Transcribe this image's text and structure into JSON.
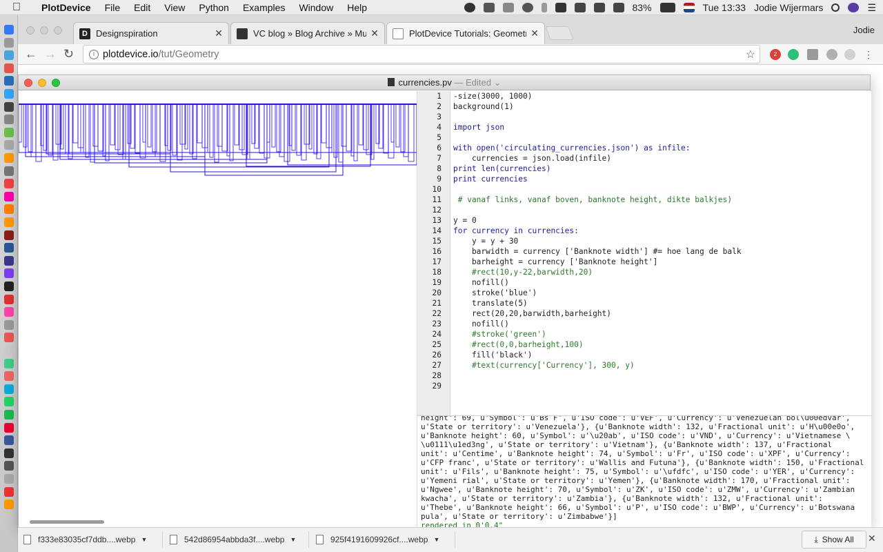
{
  "menubar": {
    "app_name": "PlotDevice",
    "menus": [
      "File",
      "Edit",
      "View",
      "Python",
      "Examples",
      "Window",
      "Help"
    ],
    "battery": "83%",
    "clock": "Tue 13:33",
    "user": "Jodie Wijermars"
  },
  "browser": {
    "profile": "Jodie",
    "tabs": [
      {
        "title": "Designspiration",
        "favicon": "D"
      },
      {
        "title": "VC blog » Blog Archive » Musi",
        "favicon": ""
      },
      {
        "title": "PlotDevice Tutorials: Geometry",
        "favicon": ""
      }
    ],
    "url_host": "plotdevice.io",
    "url_path": "/tut/Geometry",
    "ext_badge": "2"
  },
  "pd_window": {
    "filename": "currencies.pv",
    "status": "— Edited",
    "code_lines": [
      "-size(3000, 1000)",
      "background(1)",
      "",
      "import json",
      "",
      "with open('circulating_currencies.json') as infile:",
      "    currencies = json.load(infile)",
      "print len(currencies)",
      "print currencies",
      "",
      " # vanaf links, vanaf boven, banknote height, dikte balkjes)",
      "",
      "y = 0",
      "for currency in currencies:",
      "    y = y + 30",
      "    barwidth = currency ['Banknote width'] #= hoe lang de balk",
      "    barheight = currency ['Banknote height']",
      "    #rect(10,y-22,barwidth,20)",
      "    nofill()",
      "    stroke('blue')",
      "    translate(5)",
      "    rect(20,20,barwidth,barheight)",
      "    nofill()",
      "    #stroke('green')",
      "    #rect(0,0,barheight,100)",
      "    fill('black')",
      "    #text(currency['Currency'], 300, y)",
      "",
      ""
    ],
    "console_output": "height': 69, u'Symbol': u'Bs F', u'ISO code': u'VEF', u'Currency': u'Venezuelan bol\\u00edvar',\nu'State or territory': u'Venezuela'}, {u'Banknote width': 132, u'Fractional unit': u'H\\u00e0o',\nu'Banknote height': 60, u'Symbol': u'\\u20ab', u'ISO code': u'VND', u'Currency': u'Vietnamese \\\n\\u0111\\u1ed3ng', u'State or territory': u'Vietnam'}, {u'Banknote width': 137, u'Fractional\nunit': u'Centime', u'Banknote height': 74, u'Symbol': u'Fr', u'ISO code': u'XPF', u'Currency':\nu'CFP franc', u'State or territory': u'Wallis and Futuna'}, {u'Banknote width': 150, u'Fractional\nunit': u'Fils', u'Banknote height': 75, u'Symbol': u'\\ufdfc', u'ISO code': u'YER', u'Currency':\nu'Yemeni rial', u'State or territory': u'Yemen'}, {u'Banknote width': 170, u'Fractional unit':\nu'Ngwee', u'Banknote height': 70, u'Symbol': u'ZK', u'ISO code': u'ZMW', u'Currency': u'Zambian\nkwacha', u'State or territory': u'Zambia'}, {u'Banknote width': 132, u'Fractional unit':\nu'Thebe', u'Banknote height': 66, u'Symbol': u'P', u'ISO code': u'BWP', u'Currency': u'Botswana\npula', u'State or territory': u'Zimbabwe'}]",
    "rendered": "rendered in 0'0.4\""
  },
  "downloads": {
    "items": [
      "f333e83035cf7ddb....webp",
      "542d86954abbda3f....webp",
      "925f4191609926cf....webp"
    ],
    "show_all": "Show All"
  },
  "colors": {
    "stroke_blue": "#2a10e8",
    "close_red": "#fc5f57",
    "min_yellow": "#fdbc2e",
    "max_green": "#28c840"
  }
}
